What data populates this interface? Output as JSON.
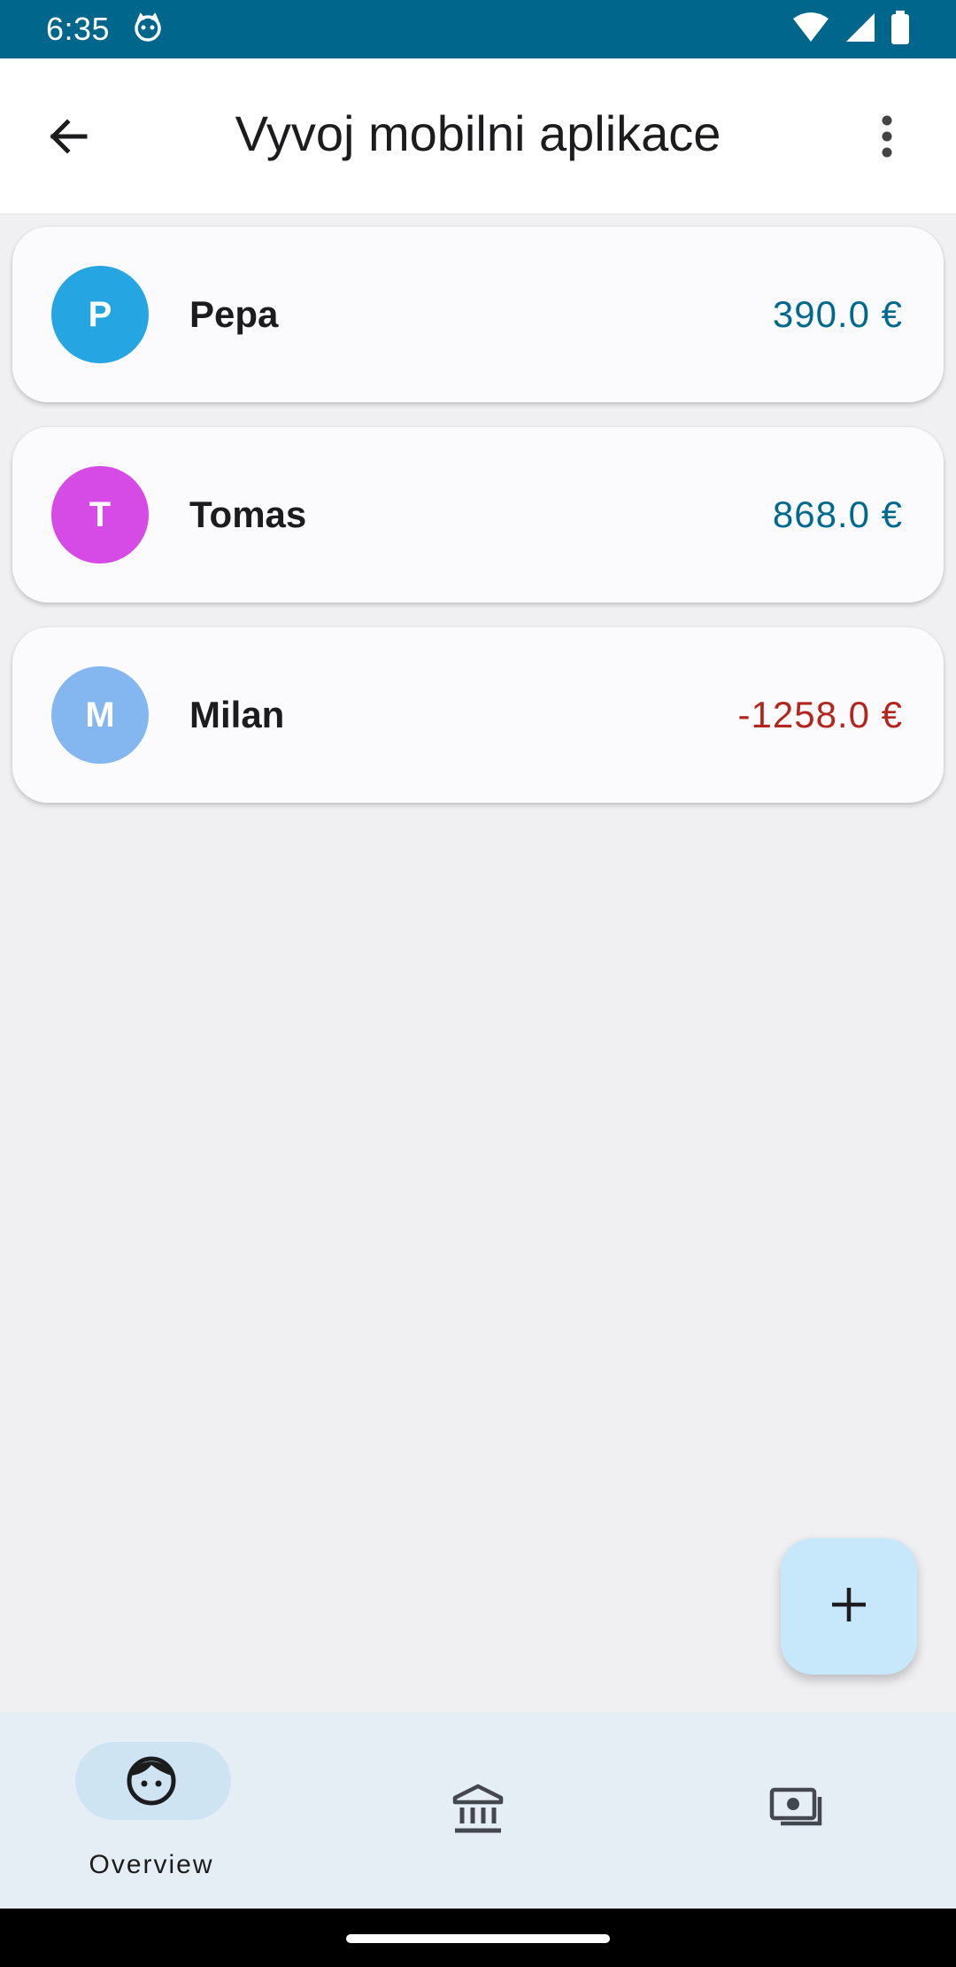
{
  "status_bar": {
    "time": "6:35",
    "icons": [
      "cat-icon",
      "wifi-icon",
      "signal-icon",
      "battery-icon"
    ]
  },
  "app_bar": {
    "title": "Vyvoj mobilni aplikace",
    "back_icon": "arrow-back-icon",
    "menu_icon": "more-vertical-icon"
  },
  "members": [
    {
      "initial": "P",
      "name": "Pepa",
      "balance": "390.0 €",
      "avatar_color": "#25a6e2",
      "balance_color": "#006a8e"
    },
    {
      "initial": "T",
      "name": "Tomas",
      "balance": "868.0 €",
      "avatar_color": "#d64ae6",
      "balance_color": "#006a8e"
    },
    {
      "initial": "M",
      "name": "Milan",
      "balance": "-1258.0 €",
      "avatar_color": "#84b7f0",
      "balance_color": "#b3261e"
    }
  ],
  "fab": {
    "icon": "plus-icon"
  },
  "bottom_nav": {
    "items": [
      {
        "label": "Overview",
        "icon": "face-icon",
        "selected": true
      },
      {
        "label": "",
        "icon": "bank-icon",
        "selected": false
      },
      {
        "label": "",
        "icon": "payments-icon",
        "selected": false
      }
    ]
  },
  "colors": {
    "status_bar": "#00668c",
    "background": "#f0f0f2",
    "fab": "#c7e7fb",
    "nav_background": "#e6eef5",
    "nav_selected_pill": "#cfe4f3"
  }
}
